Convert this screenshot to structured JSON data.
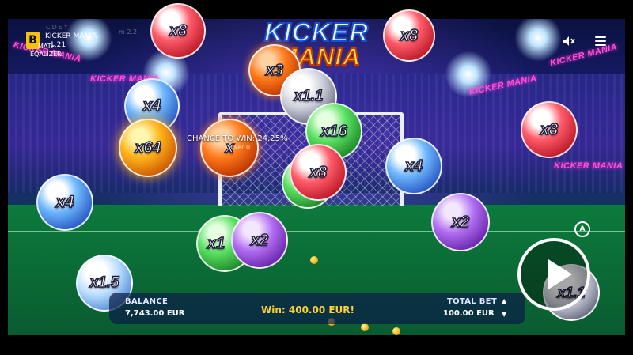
{
  "header": {
    "brand_letter": "B",
    "game_name_line1": "KICKER MANIA",
    "game_name_line2": "1.21",
    "math_line1": "MATH",
    "math_line2": "EQALIZER",
    "ghost_text1": "CDEY",
    "ghost_text2": "m 2.2"
  },
  "logo": {
    "line1": "KICKER",
    "line2": "MANIA"
  },
  "stadium_banners": [
    "KICKER MANIA",
    "KICKER MANIA",
    "KICKER MANIA",
    "KICKER MANIA",
    "KICKER MANIA"
  ],
  "chance": {
    "label": "CHANCE TO WIN: 24.25%",
    "sub": "Kicker 0"
  },
  "balls": [
    {
      "label": "x8",
      "color": "red"
    },
    {
      "label": "x8",
      "color": "red"
    },
    {
      "label": "x3",
      "color": "orange"
    },
    {
      "label": "x1.1",
      "color": "silver"
    },
    {
      "label": "x4",
      "color": "blue"
    },
    {
      "label": "x16",
      "color": "green"
    },
    {
      "label": "x64",
      "color": "gold"
    },
    {
      "label": "x",
      "color": "orange"
    },
    {
      "label": "x8",
      "color": "red"
    },
    {
      "label": "x4",
      "color": "blue"
    },
    {
      "label": "x8",
      "color": "red"
    },
    {
      "label": "x4",
      "color": "blue"
    },
    {
      "label": "x2",
      "color": "purple"
    },
    {
      "label": "x1",
      "color": "green"
    },
    {
      "label": "x2",
      "color": "purple"
    },
    {
      "label": "x1.5",
      "color": "paleblue"
    },
    {
      "label": "x1.1",
      "color": "silver"
    }
  ],
  "footer": {
    "balance_label": "BALANCE",
    "balance_value": "7,743.00 EUR",
    "win_text": "Win: 400.00 EUR!",
    "total_bet_label": "TOTAL BET",
    "total_bet_value": "100.00 EUR",
    "bet_up": "▲",
    "bet_down": "▼"
  },
  "controls": {
    "autoplay_glyph": "A",
    "play_icon": "play-icon",
    "sound_icon": "sound-muted-icon",
    "menu_icon": "hamburger-menu-icon"
  },
  "colors": {
    "win": "#ffd233",
    "logo_top": "#e8f6ff",
    "logo_bottom": "#ffe14a",
    "brand": "#f4c20d"
  }
}
